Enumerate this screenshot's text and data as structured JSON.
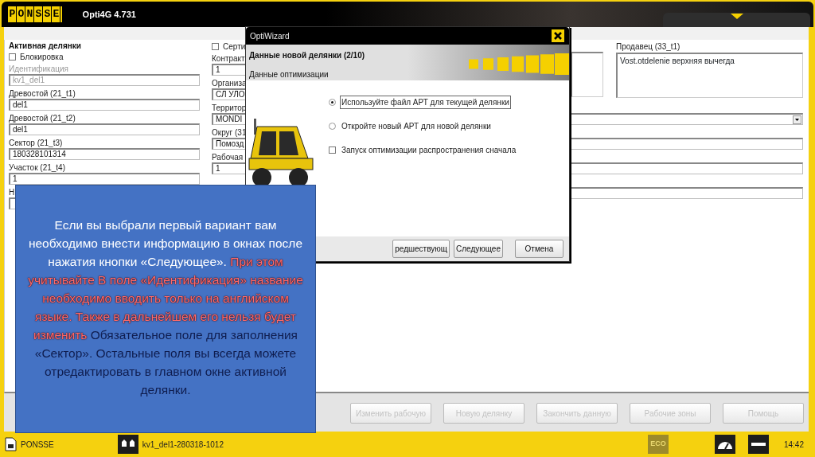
{
  "app": {
    "brand": "PONSSE",
    "title": "Opti4G 4.731"
  },
  "form": {
    "title": "Активная делянки",
    "left_fields": [
      {
        "kind": "checkbox",
        "label": "Блокировка",
        "checked": false
      },
      {
        "kind": "text",
        "label": "Идентификация",
        "value": "kv1_del1",
        "disabled": true
      },
      {
        "kind": "text",
        "label": "Древостой (21_t1)",
        "value": "del1",
        "disabled": false
      },
      {
        "kind": "text",
        "label": "Древостой (21_t2)",
        "value": "del1",
        "disabled": false
      },
      {
        "kind": "text",
        "label": "Сектор (21_t3)",
        "value": "180328101314",
        "disabled": false
      },
      {
        "kind": "text",
        "label": "Участок (21_t4)",
        "value": "1",
        "disabled": false
      },
      {
        "kind": "text",
        "label": "Н"
      }
    ],
    "middle_fields": [
      {
        "kind": "checkbox",
        "label": "Серти",
        "checked": false
      },
      {
        "kind": "text",
        "label": "Контракт",
        "value": "1"
      },
      {
        "kind": "text",
        "label": "Организа",
        "value": "СЛ УЛО"
      }
    ],
    "seller": {
      "label": "Продавец (33_t1)",
      "value": "Vost.otdelenie верхняя вычегда"
    },
    "lower_fields": [
      {
        "kind": "select",
        "label": "Территор",
        "value": "MONDI"
      },
      {
        "kind": "text",
        "label": "Округ (31",
        "value": "Помозд"
      },
      {
        "kind": "text",
        "label": "Рабочая",
        "value": "1"
      },
      {
        "kind": "text"
      }
    ],
    "buttons": [
      {
        "label": "Изменить рабочую",
        "disabled": true
      },
      {
        "label": "Новую делянку",
        "disabled": true
      },
      {
        "label": "Закончить данную",
        "disabled": true
      },
      {
        "label": "Рабочие зоны",
        "disabled": true
      },
      {
        "label": "Помощь",
        "disabled": true
      }
    ]
  },
  "dialog": {
    "title": "OptiWizard",
    "heading": "Данные новой делянки (2/10)",
    "subheading": "Данные оптимизации",
    "options": [
      {
        "kind": "radio",
        "label": "Используйте файл АРТ для текущей делянки",
        "selected": true
      },
      {
        "kind": "radio",
        "label": "Откройте новый АРТ для новой делянки",
        "selected": false
      },
      {
        "kind": "checkbox",
        "label": "Запуск оптимизации распространения сначала",
        "checked": false
      }
    ],
    "buttons": [
      "редшествующ",
      "Следующее",
      "Отмена"
    ]
  },
  "callout": {
    "segments": [
      {
        "kind": "info",
        "text": "Если вы выбрали первый вариант вам необходимо внести информацию в окнах после нажатия кнопки «Следующее»."
      },
      {
        "kind": "warning",
        "text": "При этом учитывайте В поле «Идентификация» название необходимо вводить только на английском языке. Также в дальнейшем его нельзя будет изменить"
      },
      {
        "kind": "note",
        "text": "Обязательное поле для заполнения «Сектор».  Остальные поля вы всегда можете отредактировать в главном окне активной делянки."
      }
    ]
  },
  "taskbar": {
    "items": [
      {
        "kind": "system",
        "label": "PONSSE"
      },
      {
        "kind": "stand",
        "label": "kv1_del1-280318-1012"
      }
    ],
    "eco": "ECO",
    "clock": "14:42"
  }
}
